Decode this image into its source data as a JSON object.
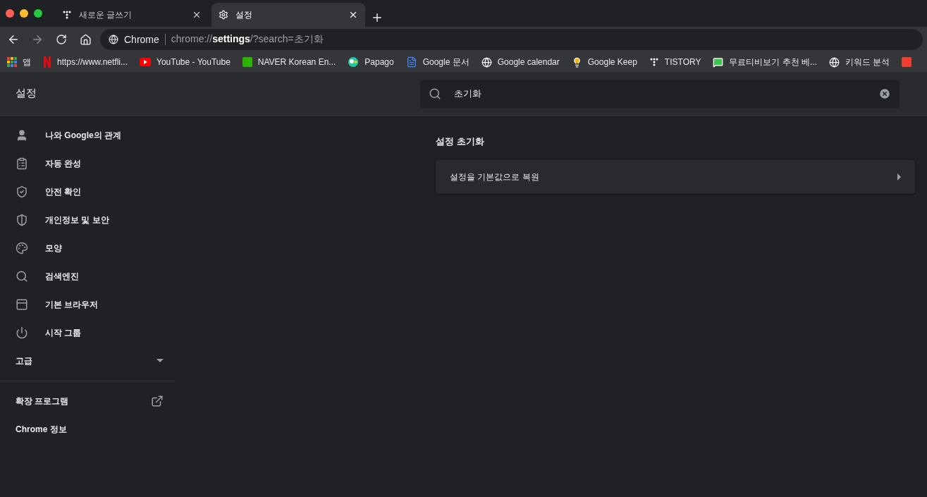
{
  "tabs": [
    {
      "title": "새로운 글쓰기",
      "kind": "tistory",
      "selected": false
    },
    {
      "title": "설정",
      "kind": "gear",
      "selected": true
    }
  ],
  "address_bar": {
    "site": "Chrome",
    "url": "chrome://**settings**/?search=초기화"
  },
  "bookmarks": [
    {
      "label": "앱",
      "kind": "apps"
    },
    {
      "label": "https://www.netfli...",
      "kind": "netflix"
    },
    {
      "label": "YouTube - YouTube",
      "kind": "youtube"
    },
    {
      "label": "NAVER Korean En...",
      "kind": "naver"
    },
    {
      "label": "Papago",
      "kind": "papago"
    },
    {
      "label": "Google 문서",
      "kind": "docs"
    },
    {
      "label": "Google calendar",
      "kind": "globe"
    },
    {
      "label": "Google Keep",
      "kind": "keep"
    },
    {
      "label": "TISTORY",
      "kind": "tistory"
    },
    {
      "label": "무료티비보기 추천 베...",
      "kind": "chat"
    },
    {
      "label": "키워드 분석",
      "kind": "globe"
    },
    {
      "kind": "red"
    }
  ],
  "settings": {
    "title": "설정",
    "search": {
      "value": "초기화"
    },
    "sidebar": {
      "items": [
        {
          "label": "나와 Google의 관계",
          "kind": "person"
        },
        {
          "label": "자동 완성",
          "kind": "clipboard"
        },
        {
          "label": "안전 확인",
          "kind": "shield-check"
        },
        {
          "label": "개인정보 및 보안",
          "kind": "shield-half"
        },
        {
          "label": "모양",
          "kind": "palette"
        },
        {
          "label": "검색엔진",
          "kind": "search"
        },
        {
          "label": "기본 브라우저",
          "kind": "browser"
        },
        {
          "label": "시작 그룹",
          "kind": "power"
        }
      ],
      "advanced": {
        "label": "고급",
        "expanded": false
      },
      "links": [
        {
          "label": "확장 프로그램",
          "external": true
        },
        {
          "label": "Chrome 정보",
          "external": false
        }
      ]
    },
    "section": {
      "title": "설정 초기화",
      "rows": [
        {
          "label": "설정을 기본값으로 복원"
        }
      ]
    }
  }
}
